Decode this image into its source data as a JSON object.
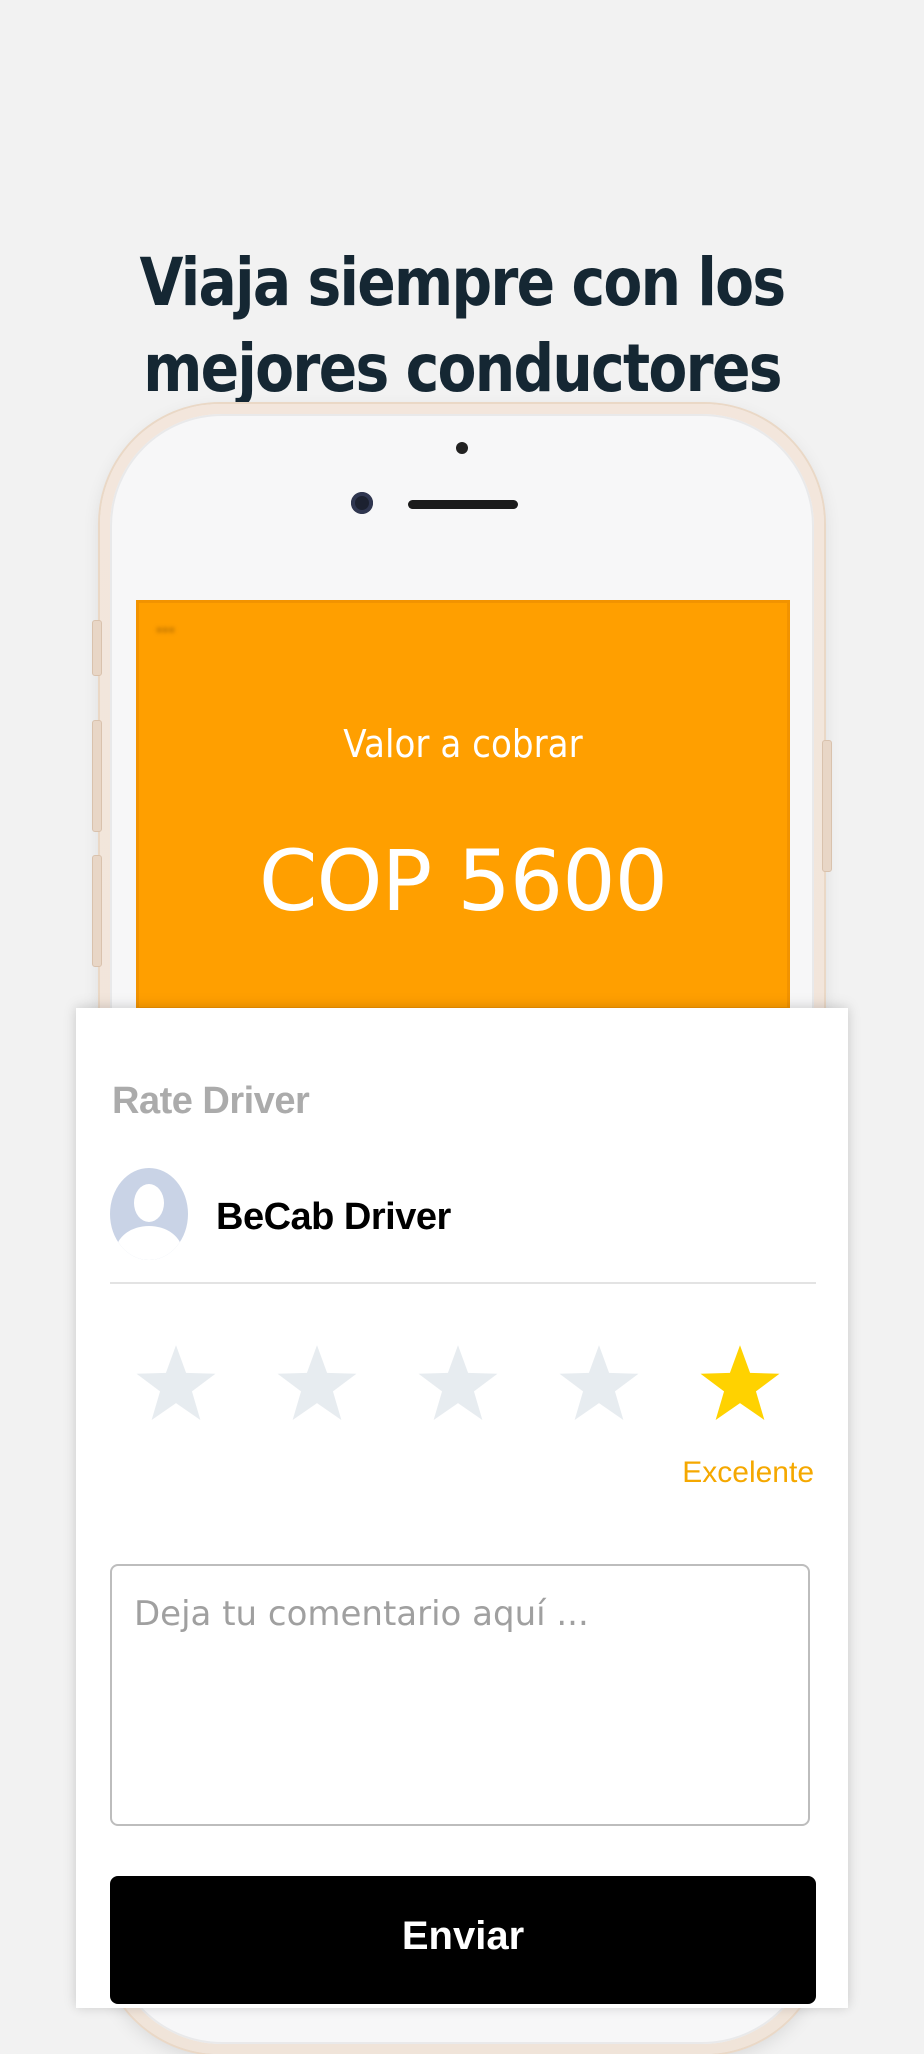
{
  "headline": {
    "line1": "Viaja siempre con los",
    "line2": "mejores conductores"
  },
  "screen": {
    "status_left": "••• ",
    "status_center": "",
    "status_right": "",
    "charge_label": "Valor a cobrar",
    "currency": "COP",
    "amount": "5600",
    "color": "#ff9f00"
  },
  "rate_card": {
    "title": "Rate Driver",
    "driver_name": "BeCab Driver",
    "rating": {
      "value": 5,
      "max": 5,
      "label": "Excelente"
    },
    "star_filled_color": "#ffd200",
    "star_empty_color": "#e7ecf0",
    "comment": {
      "value": "",
      "placeholder": "Deja tu comentario aquí ..."
    },
    "submit_label": "Enviar"
  }
}
